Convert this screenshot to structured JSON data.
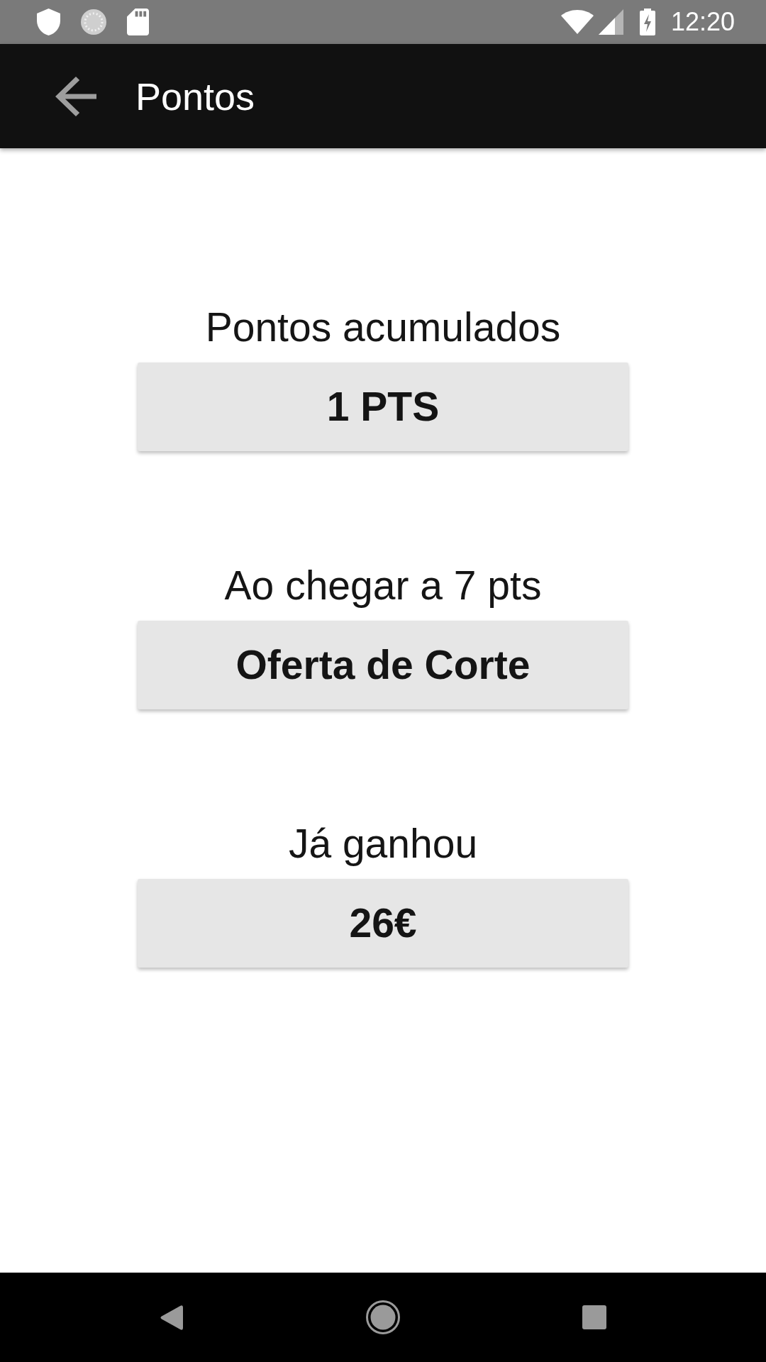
{
  "status_bar": {
    "time": "12:20"
  },
  "app_bar": {
    "title": "Pontos"
  },
  "sections": [
    {
      "label": "Pontos acumulados",
      "value": "1 PTS"
    },
    {
      "label": "Ao chegar a 7 pts",
      "value": "Oferta de Corte"
    },
    {
      "label": "Já ganhou",
      "value": "26€"
    }
  ]
}
